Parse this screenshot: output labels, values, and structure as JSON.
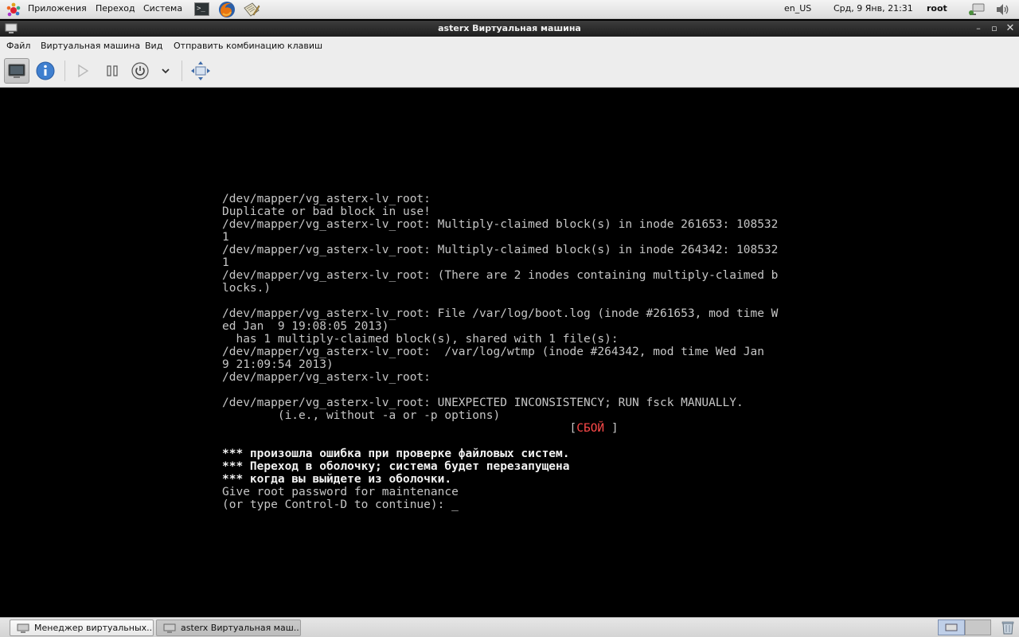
{
  "top_panel": {
    "menus": [
      "Приложения",
      "Переход",
      "Система"
    ],
    "locale": "en_US",
    "clock": "Срд,  9 Янв, 21:31",
    "user": "root",
    "launchers": [
      "terminal-icon",
      "firefox-icon",
      "text-editor-icon"
    ],
    "tray": [
      "network-icon",
      "volume-icon"
    ]
  },
  "window": {
    "title": "asterx Виртуальная машина",
    "controls": [
      "minimize-icon",
      "maximize-icon",
      "close-icon"
    ]
  },
  "menubar": {
    "items": [
      "Файл",
      "Виртуальная машина",
      "Вид",
      "Отправить комбинацию клавиш"
    ]
  },
  "toolbar": {
    "buttons": [
      "console-icon",
      "details-info-icon",
      "run-icon",
      "pause-icon",
      "power-icon",
      "chevron-down-icon",
      "fullscreen-icon"
    ],
    "active": "console-icon"
  },
  "console": {
    "lines": [
      "/dev/mapper/vg_asterx-lv_root:",
      "Duplicate or bad block in use!",
      "/dev/mapper/vg_asterx-lv_root: Multiply-claimed block(s) in inode 261653: 108532",
      "1",
      "/dev/mapper/vg_asterx-lv_root: Multiply-claimed block(s) in inode 264342: 108532",
      "1",
      "/dev/mapper/vg_asterx-lv_root: (There are 2 inodes containing multiply-claimed b",
      "locks.)",
      "",
      "/dev/mapper/vg_asterx-lv_root: File /var/log/boot.log (inode #261653, mod time W",
      "ed Jan  9 19:08:05 2013)",
      "  has 1 multiply-claimed block(s), shared with 1 file(s):",
      "/dev/mapper/vg_asterx-lv_root:  /var/log/wtmp (inode #264342, mod time Wed Jan",
      "9 21:09:54 2013)",
      "/dev/mapper/vg_asterx-lv_root:",
      "",
      "/dev/mapper/vg_asterx-lv_root: UNEXPECTED INCONSISTENCY; RUN fsck MANUALLY.",
      "        (i.e., without -a or -p options)"
    ],
    "status_pad": "                                                  ",
    "status_open": "[",
    "status_fail": "СБОЙ",
    "status_close": " ]",
    "warning_lines": [
      "*** произошла ошибка при проверке файловых систем.",
      "*** Переход в оболочку; система будет перезапущена",
      "*** когда вы выйдете из оболочки."
    ],
    "prompt_lines": [
      "Give root password for maintenance",
      "(or type Control-D to continue): "
    ],
    "cursor": "_"
  },
  "taskbar": {
    "tasks": [
      "Менеджер виртуальных...",
      "asterx Виртуальная маш..."
    ],
    "active_task": 1,
    "workspaces": 2
  },
  "colors": {
    "fail": "#ff4a4a",
    "console_bg": "#000000",
    "console_fg": "#c6c6c6"
  }
}
